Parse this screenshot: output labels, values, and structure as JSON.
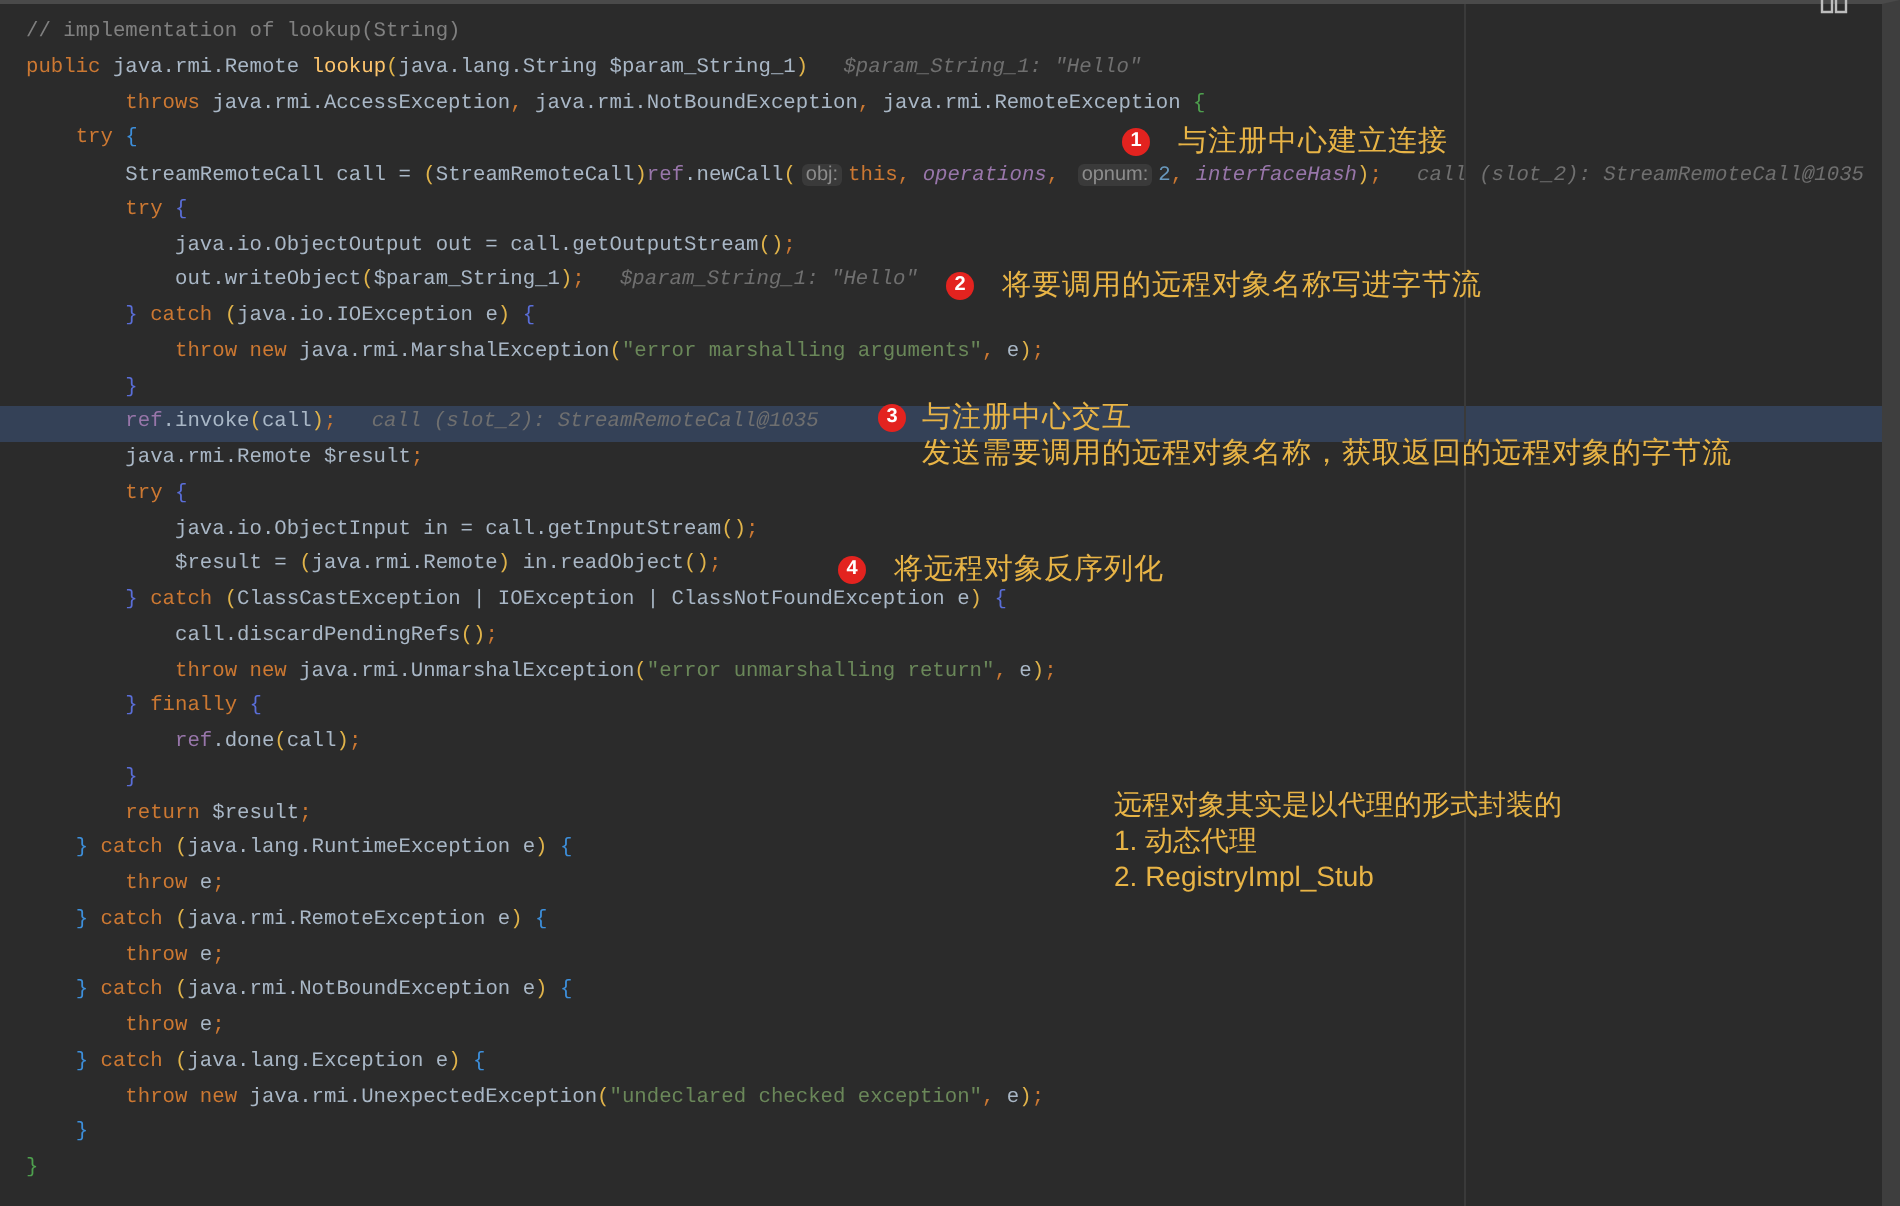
{
  "editor": {
    "lines": [
      {
        "current": false,
        "tokens": [
          {
            "kind": "comment",
            "text": "// implementation of lookup(String)"
          }
        ]
      },
      {
        "current": false,
        "tokens": [
          {
            "kind": "kw",
            "text": "public "
          },
          {
            "kind": "plain",
            "text": "java.rmi.Remote "
          },
          {
            "kind": "method",
            "text": "lookup"
          },
          {
            "kind": "paren",
            "text": "("
          },
          {
            "kind": "plain",
            "text": "java.lang.String $param_String_1"
          },
          {
            "kind": "paren",
            "text": ")"
          },
          {
            "kind": "hint",
            "text": "$param_String_1: \"Hello\""
          }
        ]
      },
      {
        "current": false,
        "tokens": [
          {
            "kind": "kw",
            "text": "        throws "
          },
          {
            "kind": "plain",
            "text": "java.rmi.AccessException"
          },
          {
            "kind": "kw",
            "text": ", "
          },
          {
            "kind": "plain",
            "text": "java.rmi.NotBoundException"
          },
          {
            "kind": "kw",
            "text": ", "
          },
          {
            "kind": "plain",
            "text": "java.rmi.RemoteException "
          },
          {
            "kind": "outer",
            "text": "{"
          }
        ]
      },
      {
        "current": false,
        "tokens": [
          {
            "kind": "kw",
            "text": "    try "
          },
          {
            "kind": "brace",
            "text": "{"
          }
        ]
      },
      {
        "current": false,
        "tokens": [
          {
            "kind": "plain",
            "text": "        StreamRemoteCall call = "
          },
          {
            "kind": "paren",
            "text": "("
          },
          {
            "kind": "plain",
            "text": "StreamRemoteCall"
          },
          {
            "kind": "paren",
            "text": ")"
          },
          {
            "kind": "field",
            "text": "ref"
          },
          {
            "kind": "plain",
            "text": ".newCall"
          },
          {
            "kind": "paren",
            "text": "("
          },
          {
            "kind": "chip",
            "text": "obj:"
          },
          {
            "kind": "kw",
            "text": "this"
          },
          {
            "kind": "kw",
            "text": ", "
          },
          {
            "kind": "static",
            "text": "operations"
          },
          {
            "kind": "kw",
            "text": ", "
          },
          {
            "kind": "chip",
            "text": "opnum:"
          },
          {
            "kind": "num",
            "text": "2"
          },
          {
            "kind": "kw",
            "text": ", "
          },
          {
            "kind": "static",
            "text": "interfaceHash"
          },
          {
            "kind": "paren",
            "text": ")"
          },
          {
            "kind": "kw",
            "text": ";"
          },
          {
            "kind": "hint",
            "text": "call (slot_2): StreamRemoteCall@1035"
          }
        ]
      },
      {
        "current": false,
        "tokens": [
          {
            "kind": "kw",
            "text": "        try "
          },
          {
            "kind": "brace2",
            "text": "{"
          }
        ]
      },
      {
        "current": false,
        "tokens": [
          {
            "kind": "plain",
            "text": "            java.io.ObjectOutput out = call.getOutputStream"
          },
          {
            "kind": "paren",
            "text": "()"
          },
          {
            "kind": "kw",
            "text": ";"
          }
        ]
      },
      {
        "current": false,
        "tokens": [
          {
            "kind": "plain",
            "text": "            out.writeObject"
          },
          {
            "kind": "paren",
            "text": "("
          },
          {
            "kind": "plain",
            "text": "$param_String_1"
          },
          {
            "kind": "paren",
            "text": ")"
          },
          {
            "kind": "kw",
            "text": ";"
          },
          {
            "kind": "hint",
            "text": "$param_String_1: \"Hello\""
          }
        ]
      },
      {
        "current": false,
        "tokens": [
          {
            "kind": "brace2",
            "text": "        }"
          },
          {
            "kind": "kw",
            "text": " catch "
          },
          {
            "kind": "paren",
            "text": "("
          },
          {
            "kind": "plain",
            "text": "java.io.IOException e"
          },
          {
            "kind": "paren",
            "text": ")"
          },
          {
            "kind": "brace2",
            "text": " {"
          }
        ]
      },
      {
        "current": false,
        "tokens": [
          {
            "kind": "kw",
            "text": "            throw new "
          },
          {
            "kind": "plain",
            "text": "java.rmi.MarshalException"
          },
          {
            "kind": "paren",
            "text": "("
          },
          {
            "kind": "str",
            "text": "\"error marshalling arguments\""
          },
          {
            "kind": "kw",
            "text": ", "
          },
          {
            "kind": "plain",
            "text": "e"
          },
          {
            "kind": "paren",
            "text": ")"
          },
          {
            "kind": "kw",
            "text": ";"
          }
        ]
      },
      {
        "current": false,
        "tokens": [
          {
            "kind": "brace2",
            "text": "        }"
          }
        ]
      },
      {
        "current": true,
        "tokens": [
          {
            "kind": "field",
            "text": "        ref"
          },
          {
            "kind": "plain",
            "text": ".invoke"
          },
          {
            "kind": "paren",
            "text": "("
          },
          {
            "kind": "plain",
            "text": "call"
          },
          {
            "kind": "paren",
            "text": ")"
          },
          {
            "kind": "kw",
            "text": ";"
          },
          {
            "kind": "hint",
            "text": "call (slot_2): StreamRemoteCall@1035"
          }
        ]
      },
      {
        "current": false,
        "tokens": [
          {
            "kind": "plain",
            "text": "        java.rmi.Remote $result"
          },
          {
            "kind": "kw",
            "text": ";"
          }
        ]
      },
      {
        "current": false,
        "tokens": [
          {
            "kind": "kw",
            "text": "        try "
          },
          {
            "kind": "brace2",
            "text": "{"
          }
        ]
      },
      {
        "current": false,
        "tokens": [
          {
            "kind": "plain",
            "text": "            java.io.ObjectInput in = call.getInputStream"
          },
          {
            "kind": "paren",
            "text": "()"
          },
          {
            "kind": "kw",
            "text": ";"
          }
        ]
      },
      {
        "current": false,
        "tokens": [
          {
            "kind": "plain",
            "text": "            $result = "
          },
          {
            "kind": "paren",
            "text": "("
          },
          {
            "kind": "plain",
            "text": "java.rmi.Remote"
          },
          {
            "kind": "paren",
            "text": ")"
          },
          {
            "kind": "plain",
            "text": " in.readObject"
          },
          {
            "kind": "paren",
            "text": "()"
          },
          {
            "kind": "kw",
            "text": ";"
          }
        ]
      },
      {
        "current": false,
        "tokens": [
          {
            "kind": "brace2",
            "text": "        }"
          },
          {
            "kind": "kw",
            "text": " catch "
          },
          {
            "kind": "paren",
            "text": "("
          },
          {
            "kind": "plain",
            "text": "ClassCastException | IOException | ClassNotFoundException e"
          },
          {
            "kind": "paren",
            "text": ")"
          },
          {
            "kind": "brace2",
            "text": " {"
          }
        ]
      },
      {
        "current": false,
        "tokens": [
          {
            "kind": "plain",
            "text": "            call.discardPendingRefs"
          },
          {
            "kind": "paren",
            "text": "()"
          },
          {
            "kind": "kw",
            "text": ";"
          }
        ]
      },
      {
        "current": false,
        "tokens": [
          {
            "kind": "kw",
            "text": "            throw new "
          },
          {
            "kind": "plain",
            "text": "java.rmi.UnmarshalException"
          },
          {
            "kind": "paren",
            "text": "("
          },
          {
            "kind": "str",
            "text": "\"error unmarshalling return\""
          },
          {
            "kind": "kw",
            "text": ", "
          },
          {
            "kind": "plain",
            "text": "e"
          },
          {
            "kind": "paren",
            "text": ")"
          },
          {
            "kind": "kw",
            "text": ";"
          }
        ]
      },
      {
        "current": false,
        "tokens": [
          {
            "kind": "brace2",
            "text": "        }"
          },
          {
            "kind": "kw",
            "text": " finally "
          },
          {
            "kind": "brace2",
            "text": "{"
          }
        ]
      },
      {
        "current": false,
        "tokens": [
          {
            "kind": "field",
            "text": "            ref"
          },
          {
            "kind": "plain",
            "text": ".done"
          },
          {
            "kind": "paren",
            "text": "("
          },
          {
            "kind": "plain",
            "text": "call"
          },
          {
            "kind": "paren",
            "text": ")"
          },
          {
            "kind": "kw",
            "text": ";"
          }
        ]
      },
      {
        "current": false,
        "tokens": [
          {
            "kind": "brace2",
            "text": "        }"
          }
        ]
      },
      {
        "current": false,
        "tokens": [
          {
            "kind": "kw",
            "text": "        return "
          },
          {
            "kind": "plain",
            "text": "$result"
          },
          {
            "kind": "kw",
            "text": ";"
          }
        ]
      },
      {
        "current": false,
        "tokens": [
          {
            "kind": "brace",
            "text": "    }"
          },
          {
            "kind": "kw",
            "text": " catch "
          },
          {
            "kind": "paren",
            "text": "("
          },
          {
            "kind": "plain",
            "text": "java.lang.RuntimeException e"
          },
          {
            "kind": "paren",
            "text": ")"
          },
          {
            "kind": "brace",
            "text": " {"
          }
        ]
      },
      {
        "current": false,
        "tokens": [
          {
            "kind": "kw",
            "text": "        throw "
          },
          {
            "kind": "plain",
            "text": "e"
          },
          {
            "kind": "kw",
            "text": ";"
          }
        ]
      },
      {
        "current": false,
        "tokens": [
          {
            "kind": "brace",
            "text": "    }"
          },
          {
            "kind": "kw",
            "text": " catch "
          },
          {
            "kind": "paren",
            "text": "("
          },
          {
            "kind": "plain",
            "text": "java.rmi.RemoteException e"
          },
          {
            "kind": "paren",
            "text": ")"
          },
          {
            "kind": "brace",
            "text": " {"
          }
        ]
      },
      {
        "current": false,
        "tokens": [
          {
            "kind": "kw",
            "text": "        throw "
          },
          {
            "kind": "plain",
            "text": "e"
          },
          {
            "kind": "kw",
            "text": ";"
          }
        ]
      },
      {
        "current": false,
        "tokens": [
          {
            "kind": "brace",
            "text": "    }"
          },
          {
            "kind": "kw",
            "text": " catch "
          },
          {
            "kind": "paren",
            "text": "("
          },
          {
            "kind": "plain",
            "text": "java.rmi.NotBoundException e"
          },
          {
            "kind": "paren",
            "text": ")"
          },
          {
            "kind": "brace",
            "text": " {"
          }
        ]
      },
      {
        "current": false,
        "tokens": [
          {
            "kind": "kw",
            "text": "        throw "
          },
          {
            "kind": "plain",
            "text": "e"
          },
          {
            "kind": "kw",
            "text": ";"
          }
        ]
      },
      {
        "current": false,
        "tokens": [
          {
            "kind": "brace",
            "text": "    }"
          },
          {
            "kind": "kw",
            "text": " catch "
          },
          {
            "kind": "paren",
            "text": "("
          },
          {
            "kind": "plain",
            "text": "java.lang.Exception e"
          },
          {
            "kind": "paren",
            "text": ")"
          },
          {
            "kind": "brace",
            "text": " {"
          }
        ]
      },
      {
        "current": false,
        "tokens": [
          {
            "kind": "kw",
            "text": "        throw new "
          },
          {
            "kind": "plain",
            "text": "java.rmi.UnexpectedException"
          },
          {
            "kind": "paren",
            "text": "("
          },
          {
            "kind": "str",
            "text": "\"undeclared checked exception\""
          },
          {
            "kind": "kw",
            "text": ", "
          },
          {
            "kind": "plain",
            "text": "e"
          },
          {
            "kind": "paren",
            "text": ")"
          },
          {
            "kind": "kw",
            "text": ";"
          }
        ]
      },
      {
        "current": false,
        "tokens": [
          {
            "kind": "brace",
            "text": "    }"
          }
        ]
      },
      {
        "current": false,
        "tokens": [
          {
            "kind": "outer",
            "text": "}"
          }
        ]
      }
    ]
  },
  "annotations": [
    {
      "number": "1",
      "lines": [
        "与注册中心建立连接"
      ]
    },
    {
      "number": "2",
      "lines": [
        "将要调用的远程对象名称写进字节流"
      ]
    },
    {
      "number": "3",
      "lines": [
        "与注册中心交互",
        "发送需要调用的远程对象名称，获取返回的远程对象的字节流"
      ]
    },
    {
      "number": "4",
      "lines": [
        "将远程对象反序列化"
      ]
    }
  ],
  "note": {
    "lines": [
      "远程对象其实是以代理的形式封装的",
      "1. 动态代理",
      "2. RegistryImpl_Stub"
    ]
  }
}
